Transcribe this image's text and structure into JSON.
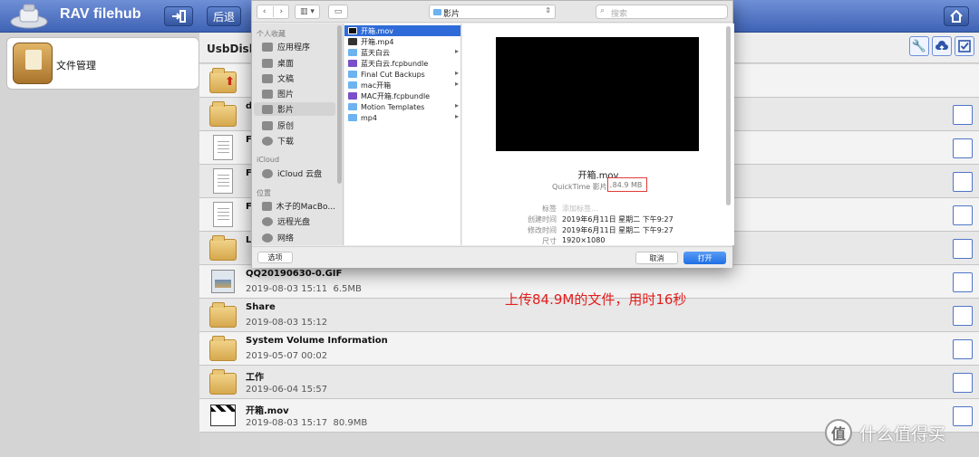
{
  "app": {
    "title": "RAV filehub"
  },
  "toolbar": {
    "back_label": "后退"
  },
  "sidebar": {
    "items": [
      {
        "label": "文件管理"
      }
    ]
  },
  "main": {
    "path": "UsbDisk1",
    "files": [
      {
        "name": "",
        "meta": "",
        "icon": "folder-up-icon"
      },
      {
        "name": "d",
        "meta": "",
        "icon": "folder-icon"
      },
      {
        "name": "F",
        "meta": "",
        "icon": "document-icon"
      },
      {
        "name": "F",
        "meta": "",
        "icon": "document-icon"
      },
      {
        "name": "F",
        "meta": "",
        "icon": "document-icon"
      },
      {
        "name": "L",
        "meta": "",
        "icon": "folder-icon"
      },
      {
        "name": "QQ20190630-0.GIF",
        "meta": "2019-08-03 15:11  6.5MB",
        "icon": "image-icon"
      },
      {
        "name": "Share",
        "meta": "2019-08-03 15:12",
        "icon": "folder-icon"
      },
      {
        "name": "System Volume Information",
        "meta": "2019-05-07 00:02",
        "icon": "folder-icon"
      },
      {
        "name": "工作",
        "meta": "2019-06-04 15:57",
        "icon": "folder-icon"
      },
      {
        "name": "开箱.mov",
        "meta": "2019-08-03 15:17  80.9MB",
        "icon": "video-icon"
      }
    ]
  },
  "dialog": {
    "location": "影片",
    "search_placeholder": "搜索",
    "sidebar": {
      "section_favorites": "个人收藏",
      "favorites": [
        "应用程序",
        "桌面",
        "文稿",
        "图片",
        "影片",
        "原创",
        "下载"
      ],
      "section_icloud": "iCloud",
      "icloud": [
        "iCloud 云盘"
      ],
      "section_locations": "位置",
      "locations": [
        "木子的MacBo...",
        "远程光盘",
        "网络"
      ]
    },
    "files": [
      {
        "name": "开箱.mov",
        "arrow": false,
        "selected": true,
        "color": "#222222"
      },
      {
        "name": "开箱.mp4",
        "arrow": false,
        "selected": false,
        "color": "#333333"
      },
      {
        "name": "蓝天白云",
        "arrow": true,
        "selected": false,
        "color": "#6cb3f0"
      },
      {
        "name": "蓝天白云.fcpbundle",
        "arrow": false,
        "selected": false,
        "color": "#7a4fc9"
      },
      {
        "name": "Final Cut Backups",
        "arrow": true,
        "selected": false,
        "color": "#6cb3f0"
      },
      {
        "name": "mac开箱",
        "arrow": true,
        "selected": false,
        "color": "#6cb3f0"
      },
      {
        "name": "MAC开箱.fcpbundle",
        "arrow": false,
        "selected": false,
        "color": "#7a4fc9"
      },
      {
        "name": "Motion Templates",
        "arrow": true,
        "selected": false,
        "color": "#6cb3f0"
      },
      {
        "name": "mp4",
        "arrow": true,
        "selected": false,
        "color": "#6cb3f0"
      }
    ],
    "preview": {
      "name": "开箱.mov",
      "kind": "QuickTime 影片 - ",
      "size": "84.9 MB",
      "tags_label": "标签",
      "tags_placeholder": "添加标签...",
      "created_label": "创建时间",
      "created_value": "2019年6月11日 星期二 下午9:27",
      "modified_label": "修改时间",
      "modified_value": "2019年6月11日 星期二 下午9:27",
      "dimensions_label": "尺寸",
      "dimensions_value": "1920×1080"
    },
    "options_label": "选项",
    "cancel_label": "取消",
    "open_label": "打开"
  },
  "annotation": "上传84.9M的文件，用时16秒",
  "watermark": {
    "logo": "值",
    "text": "什么值得买"
  },
  "colors": {
    "accent": "#3f63b5",
    "highlight": "#2f6bd8",
    "annotation": "#e21d1d"
  }
}
